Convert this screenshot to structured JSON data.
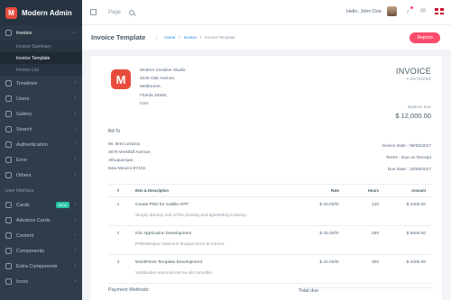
{
  "app": {
    "brand_letter": "M",
    "brand_name": "Modern Admin"
  },
  "sidebar": {
    "items_top": [
      {
        "label": "Invoice",
        "open": true
      }
    ],
    "invoice_sub": [
      "Invoice Summary",
      "Invoice Template",
      "Invoice List"
    ],
    "items": [
      "Timelines",
      "Users",
      "Gallery",
      "Search",
      "Authentication",
      "Error",
      "Others"
    ],
    "section": "User Interface",
    "ui_items": [
      "Cards",
      "Advance Cards",
      "Content",
      "Components",
      "Extra Components",
      "Icons"
    ],
    "new_badge": "NEW"
  },
  "topbar": {
    "page": "Page",
    "hello": "Hello, John Doe",
    "notify_count": "5"
  },
  "page": {
    "title": "Invoice Template",
    "breadcrumb": [
      "Home",
      "Invoice",
      "Invoice Template"
    ],
    "new_button": "Reports"
  },
  "invoice": {
    "logo_letter": "M",
    "company_lines": [
      "Modern Creative Studio",
      "4025 Oak Avenue,",
      "Melbourne,",
      "Florida 32940,",
      "USA"
    ],
    "heading": "INVOICE",
    "number": "# INV-001001",
    "balance_label": "Balance Due",
    "balance_value": "$ 12,000.00",
    "bill_to_heading": "Bill To",
    "bill_to_lines": [
      "Mr. Bret Lezama",
      "4879 Westfall Avenue,",
      "Albuquerque,",
      "New Mexico-87102."
    ],
    "dates": [
      "Invoice Date : 06/05/2017",
      "Terms : Due on Receipt",
      "Due Date : 10/05/2017"
    ],
    "table_headers": {
      "num": "#",
      "desc": "Item & Description",
      "rate": "Rate",
      "hours": "Hours",
      "amount": "Amount"
    },
    "rows": [
      {
        "num": "1",
        "title": "Create PSD for mobile APP",
        "desc": "Simply dummy text of the printing and typesetting industry.",
        "rate": "$ 20.00/hr",
        "hours": "120",
        "amount": "$ 2400.00"
      },
      {
        "num": "2",
        "title": "iOS Application Development",
        "desc": "Pellentesque maximus feugiat lorem at cursus.",
        "rate": "$ 25.00/hr",
        "hours": "260",
        "amount": "$ 6500.00"
      },
      {
        "num": "3",
        "title": "WordPress Template Development",
        "desc": "Vestibulum euismod est eu elit convallis.",
        "rate": "$ 20.00/hr",
        "hours": "300",
        "amount": "$ 4000.00"
      }
    ],
    "payment_heading": "Payment Methods:",
    "total_heading": "Total due"
  },
  "colors": {
    "sidebar": "#2f3d4a",
    "accent": "#fc4b6c",
    "brand": "#e74c3c",
    "link": "#1e88e5"
  }
}
